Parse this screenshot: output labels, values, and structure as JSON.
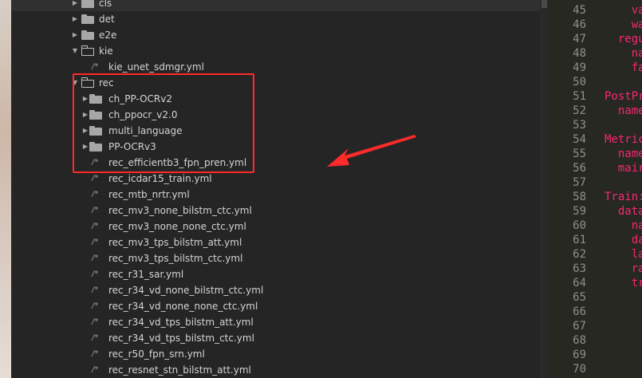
{
  "tree": [
    {
      "kind": "folder",
      "state": "collapsed",
      "label": "cls",
      "level": 1
    },
    {
      "kind": "folder",
      "state": "collapsed",
      "label": "det",
      "level": 1
    },
    {
      "kind": "folder",
      "state": "collapsed",
      "label": "e2e",
      "level": 1
    },
    {
      "kind": "folder",
      "state": "expanded",
      "label": "kie",
      "level": 1
    },
    {
      "kind": "file",
      "label": "kie_unet_sdmgr.yml",
      "level": 2
    },
    {
      "kind": "folder",
      "state": "expanded",
      "label": "rec",
      "level": 1
    },
    {
      "kind": "folder",
      "state": "collapsed",
      "label": "ch_PP-OCRv2",
      "level": 2
    },
    {
      "kind": "folder",
      "state": "collapsed",
      "label": "ch_ppocr_v2.0",
      "level": 2
    },
    {
      "kind": "folder",
      "state": "collapsed",
      "label": "multi_language",
      "level": 2
    },
    {
      "kind": "folder",
      "state": "collapsed",
      "label": "PP-OCRv3",
      "level": 2
    },
    {
      "kind": "file",
      "label": "rec_efficientb3_fpn_pren.yml",
      "level": 2
    },
    {
      "kind": "file",
      "label": "rec_icdar15_train.yml",
      "level": 2
    },
    {
      "kind": "file",
      "label": "rec_mtb_nrtr.yml",
      "level": 2
    },
    {
      "kind": "file",
      "label": "rec_mv3_none_bilstm_ctc.yml",
      "level": 2
    },
    {
      "kind": "file",
      "label": "rec_mv3_none_none_ctc.yml",
      "level": 2
    },
    {
      "kind": "file",
      "label": "rec_mv3_tps_bilstm_att.yml",
      "level": 2
    },
    {
      "kind": "file",
      "label": "rec_mv3_tps_bilstm_ctc.yml",
      "level": 2
    },
    {
      "kind": "file",
      "label": "rec_r31_sar.yml",
      "level": 2
    },
    {
      "kind": "file",
      "label": "rec_r34_vd_none_bilstm_ctc.yml",
      "level": 2
    },
    {
      "kind": "file",
      "label": "rec_r34_vd_none_none_ctc.yml",
      "level": 2
    },
    {
      "kind": "file",
      "label": "rec_r34_vd_tps_bilstm_att.yml",
      "level": 2
    },
    {
      "kind": "file",
      "label": "rec_r34_vd_tps_bilstm_ctc.yml",
      "level": 2
    },
    {
      "kind": "file",
      "label": "rec_r50_fpn_srn.yml",
      "level": 2
    },
    {
      "kind": "file",
      "label": "rec_resnet_stn_bilstm_att.yml",
      "level": 2
    }
  ],
  "icons": {
    "collapsed_arrow": "▶",
    "expanded_arrow": "▼",
    "file": "/*"
  },
  "editor": {
    "line_numbers": [
      "45",
      "46",
      "47",
      "48",
      "49",
      "50",
      "51",
      "52",
      "53",
      "54",
      "55",
      "56",
      "57",
      "58",
      "59",
      "60",
      "61",
      "62",
      "63",
      "64",
      "65",
      "66",
      "67",
      "68",
      "69",
      "70"
    ],
    "code": [
      "    va",
      "    wa",
      "  regu",
      "    na",
      "    fa",
      "",
      "PostPr",
      "  name",
      "",
      "Metric",
      "  name",
      "  mair",
      "",
      "Train:",
      "  data",
      "    na",
      "    da",
      "    la",
      "    ra",
      "    tr",
      "",
      "",
      "",
      "",
      "",
      ""
    ]
  },
  "colors": {
    "annotation_red": "#ff2a2a",
    "sidebar_bg": "#252526",
    "editor_bg": "#272822"
  }
}
